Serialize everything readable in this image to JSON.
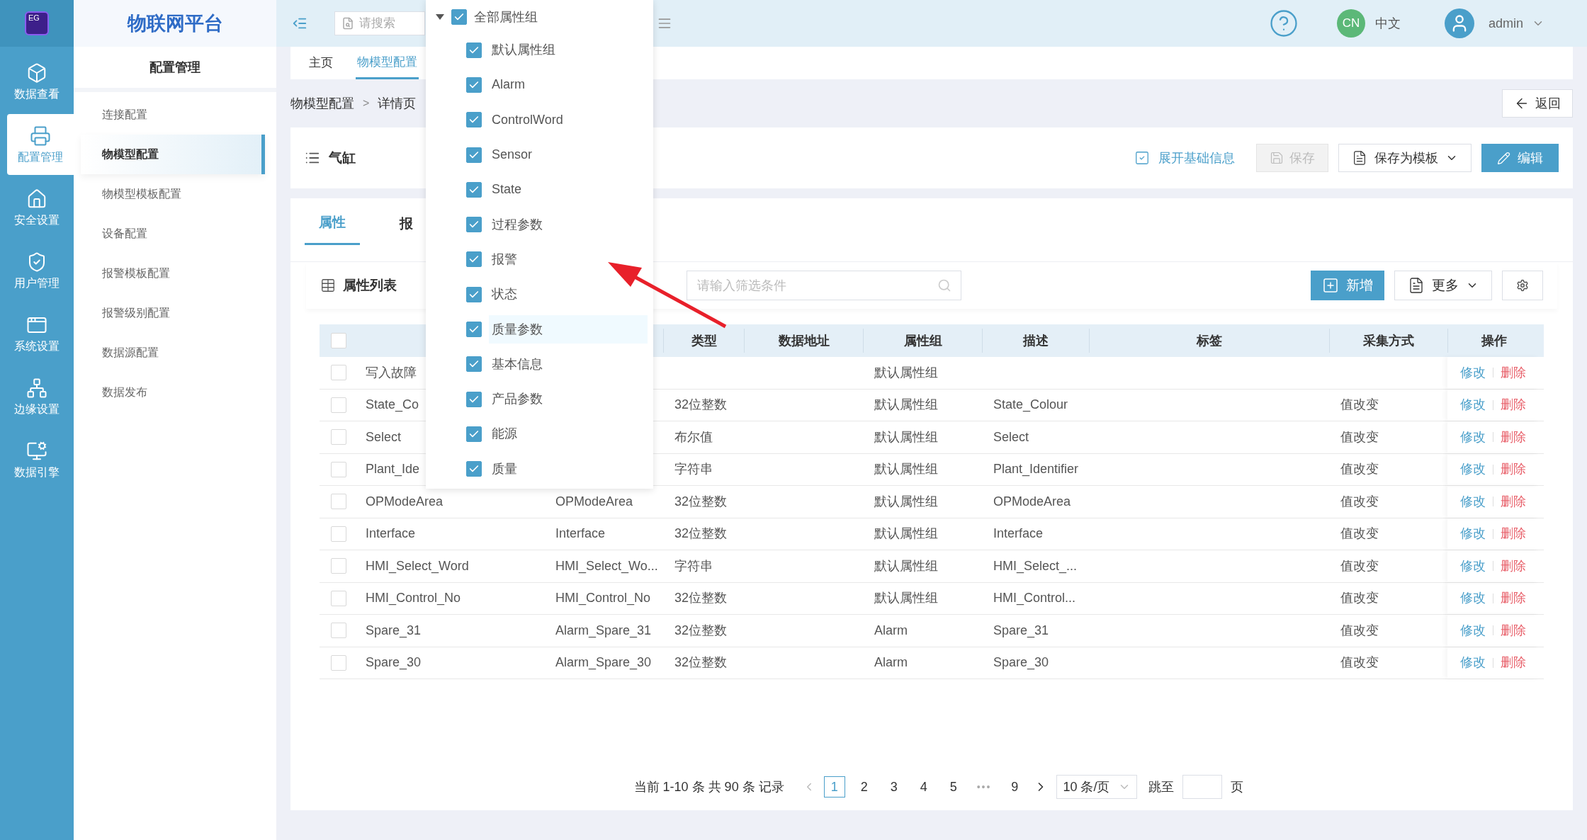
{
  "logo": {
    "text": "EG"
  },
  "rail": [
    {
      "label": "数据查看",
      "selected": false
    },
    {
      "label": "配置管理",
      "selected": true
    },
    {
      "label": "安全设置",
      "selected": false
    },
    {
      "label": "用户管理",
      "selected": false
    },
    {
      "label": "系统设置",
      "selected": false
    },
    {
      "label": "边缘设置",
      "selected": false
    },
    {
      "label": "数据引擎",
      "selected": false
    }
  ],
  "app_title": "物联网平台",
  "section_title": "配置管理",
  "menu": [
    {
      "label": "连接配置",
      "selected": false
    },
    {
      "label": "物模型配置",
      "selected": true
    },
    {
      "label": "物模型模板配置",
      "selected": false
    },
    {
      "label": "设备配置",
      "selected": false
    },
    {
      "label": "报警模板配置",
      "selected": false
    },
    {
      "label": "报警级别配置",
      "selected": false
    },
    {
      "label": "数据源配置",
      "selected": false
    },
    {
      "label": "数据发布",
      "selected": false
    }
  ],
  "topbar": {
    "search": {
      "placeholder": "请搜索"
    },
    "language_badge": "CN",
    "language": "中文",
    "user": "admin"
  },
  "page_tabs": [
    {
      "label": "主页",
      "selected": false
    },
    {
      "label": "物模型配置",
      "selected": true
    }
  ],
  "breadcrumb": {
    "items": [
      "物模型配置",
      "详情页"
    ],
    "separator": ">"
  },
  "back_button": "返回",
  "header": {
    "title": "气缸",
    "expand_link": "展开基础信息",
    "buttons": [
      {
        "label": "保存",
        "kind": "disabled"
      },
      {
        "label": "保存为模板",
        "kind": "dropdown"
      },
      {
        "label": "编辑",
        "kind": "primary"
      }
    ]
  },
  "content_tabs": [
    {
      "label": "属性",
      "selected": true
    },
    {
      "label": "报",
      "selected": false
    }
  ],
  "list": {
    "title": "属性列表",
    "filter": {
      "placeholder": "请输入筛选条件"
    },
    "actions": [
      {
        "label": "新增",
        "kind": "primary"
      },
      {
        "label": "更多",
        "kind": "dropdown"
      }
    ]
  },
  "table": {
    "header_checked": false,
    "columns": [
      "类型",
      "数据地址",
      "属性组",
      "描述",
      "标签",
      "采集方式",
      "操作"
    ],
    "rows": [
      {
        "checked": false,
        "name": "写入故障",
        "group": "默认属性组",
        "actions": [
          "修改",
          "删除"
        ]
      },
      {
        "checked": false,
        "name": "State_Co",
        "type": "32位整数",
        "group": "默认属性组",
        "description": "State_Colour",
        "method": "值改变",
        "actions": [
          "修改",
          "删除"
        ]
      },
      {
        "checked": false,
        "name": "Select",
        "type": "布尔值",
        "group": "默认属性组",
        "description": "Select",
        "method": "值改变",
        "actions": [
          "修改",
          "删除"
        ]
      },
      {
        "checked": false,
        "name": "Plant_Ide",
        "type": "字符串",
        "group": "默认属性组",
        "description": "Plant_Identifier",
        "method": "值改变",
        "actions": [
          "修改",
          "删除"
        ]
      },
      {
        "checked": false,
        "name": "OPModeArea",
        "identifier": "OPModeArea",
        "type": "32位整数",
        "group": "默认属性组",
        "description": "OPModeArea",
        "method": "值改变",
        "actions": [
          "修改",
          "删除"
        ]
      },
      {
        "checked": false,
        "name": "Interface",
        "identifier": "Interface",
        "type": "32位整数",
        "group": "默认属性组",
        "description": "Interface",
        "method": "值改变",
        "actions": [
          "修改",
          "删除"
        ]
      },
      {
        "checked": false,
        "name": "HMI_Select_Word",
        "identifier": "HMI_Select_Wo...",
        "type": "字符串",
        "group": "默认属性组",
        "description": "HMI_Select_...",
        "method": "值改变",
        "actions": [
          "修改",
          "删除"
        ]
      },
      {
        "checked": false,
        "name": "HMI_Control_No",
        "identifier": "HMI_Control_No",
        "type": "32位整数",
        "group": "默认属性组",
        "description": "HMI_Control...",
        "method": "值改变",
        "actions": [
          "修改",
          "删除"
        ]
      },
      {
        "checked": false,
        "name": "Spare_31",
        "identifier": "Alarm_Spare_31",
        "type": "32位整数",
        "group": "Alarm",
        "description": "Spare_31",
        "method": "值改变",
        "actions": [
          "修改",
          "删除"
        ]
      },
      {
        "checked": false,
        "name": "Spare_30",
        "identifier": "Alarm_Spare_30",
        "type": "32位整数",
        "group": "Alarm",
        "description": "Spare_30",
        "method": "值改变",
        "actions": [
          "修改",
          "删除"
        ]
      }
    ]
  },
  "pagination": {
    "summary": "当前 1-10 条 共 90 条 记录",
    "pages": [
      {
        "label": "1",
        "kind": "page",
        "selected": true
      },
      {
        "label": "2",
        "kind": "page",
        "selected": false
      },
      {
        "label": "3",
        "kind": "page",
        "selected": false
      },
      {
        "label": "4",
        "kind": "page",
        "selected": false
      },
      {
        "label": "5",
        "kind": "page",
        "selected": false
      },
      {
        "label": "•••",
        "kind": "ellipsis"
      },
      {
        "label": "9",
        "kind": "page",
        "selected": false
      }
    ],
    "page_size": "10 条/页",
    "jump_label": "跳至",
    "page_suffix": "页"
  },
  "group_filter": {
    "label": "全部属性组",
    "checked": true,
    "expanded": true,
    "children": [
      {
        "label": "默认属性组",
        "checked": true,
        "selected": false
      },
      {
        "label": "Alarm",
        "checked": true,
        "selected": false
      },
      {
        "label": "ControlWord",
        "checked": true,
        "selected": false
      },
      {
        "label": "Sensor",
        "checked": true,
        "selected": false
      },
      {
        "label": "State",
        "checked": true,
        "selected": false
      },
      {
        "label": "过程参数",
        "checked": true,
        "selected": false
      },
      {
        "label": "报警",
        "checked": true,
        "selected": false
      },
      {
        "label": "状态",
        "checked": true,
        "selected": false
      },
      {
        "label": "质量参数",
        "checked": true,
        "selected": true
      },
      {
        "label": "基本信息",
        "checked": true,
        "selected": false
      },
      {
        "label": "产品参数",
        "checked": true,
        "selected": false
      },
      {
        "label": "能源",
        "checked": true,
        "selected": false
      },
      {
        "label": "质量",
        "checked": true,
        "selected": false
      }
    ]
  }
}
